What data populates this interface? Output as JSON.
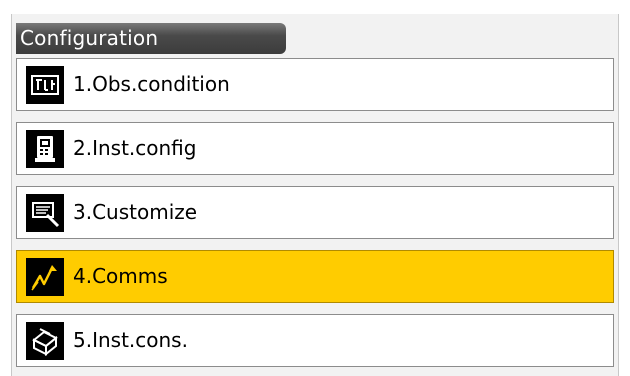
{
  "header": {
    "title": "Configuration"
  },
  "menu": {
    "items": [
      {
        "label": "1.Obs.condition",
        "icon": "obs-condition-icon"
      },
      {
        "label": "2.Inst.config",
        "icon": "instrument-config-icon"
      },
      {
        "label": "3.Customize",
        "icon": "customize-icon"
      },
      {
        "label": "4.Comms",
        "icon": "comms-icon",
        "selected": true
      },
      {
        "label": "5.Inst.cons.",
        "icon": "instrument-constants-icon"
      }
    ]
  },
  "colors": {
    "selected_background": "#ffcc00",
    "title_bar": "#3c3c3c",
    "item_background": "#ffffff"
  }
}
